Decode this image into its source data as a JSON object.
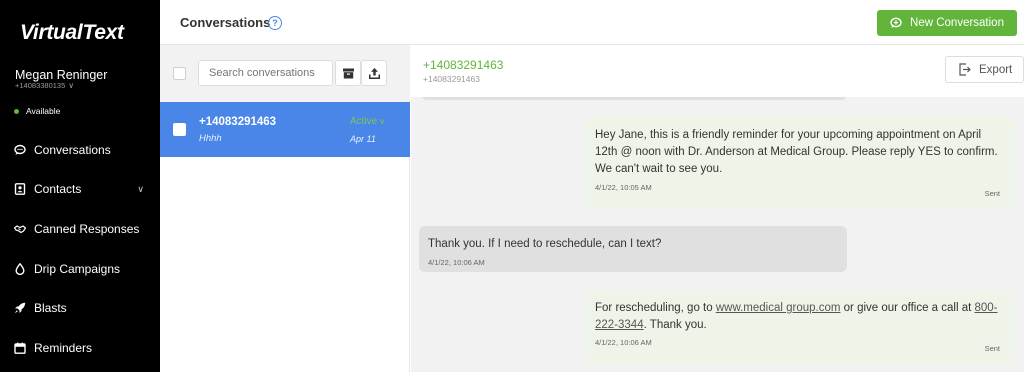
{
  "app": {
    "logo": "VirtualText",
    "user_name": "Megan Reninger",
    "user_phone": "+14083380135",
    "status": "Available",
    "brand_green": "#62b53a",
    "brand_blue": "#4a86e8"
  },
  "sidebar": {
    "items": [
      {
        "label": "Conversations",
        "icon": "chat-bubble-icon"
      },
      {
        "label": "Contacts",
        "icon": "contact-card-icon",
        "expandable": true
      },
      {
        "label": "Canned Responses",
        "icon": "handshake-icon"
      },
      {
        "label": "Drip Campaigns",
        "icon": "drop-icon"
      },
      {
        "label": "Blasts",
        "icon": "rocket-icon"
      },
      {
        "label": "Reminders",
        "icon": "calendar-icon"
      }
    ]
  },
  "header": {
    "title": "Conversations",
    "help": "?",
    "new_button": "New Conversation"
  },
  "list": {
    "search_placeholder": "Search conversations",
    "items": [
      {
        "phone": "+14083291463",
        "preview": "Hhhh",
        "status": "Active",
        "date": "Apr 11",
        "selected": true
      }
    ]
  },
  "chat": {
    "phone": "+14083291463",
    "sub": "+14083291463",
    "export_label": "Export",
    "messages": [
      {
        "direction": "out",
        "text": "Hey Jane, this is a friendly reminder for your upcoming appointment on April 12th @ noon with Dr. Anderson at Medical Group. Please reply YES to confirm. We can't wait to see you.",
        "time": "4/1/22, 10:05 AM",
        "status": "Sent"
      },
      {
        "direction": "in",
        "text": "Thank you. If I need to reschedule, can I text?",
        "time": "4/1/22, 10:06 AM"
      },
      {
        "direction": "out",
        "text_before": "For rescheduling, go to ",
        "link1": "www.medical group.com",
        "text_middle": " or give our office a call at ",
        "link2": "800-222-3344",
        "text_after": ". Thank you.",
        "time": "4/1/22, 10:06 AM",
        "status": "Sent"
      }
    ]
  }
}
